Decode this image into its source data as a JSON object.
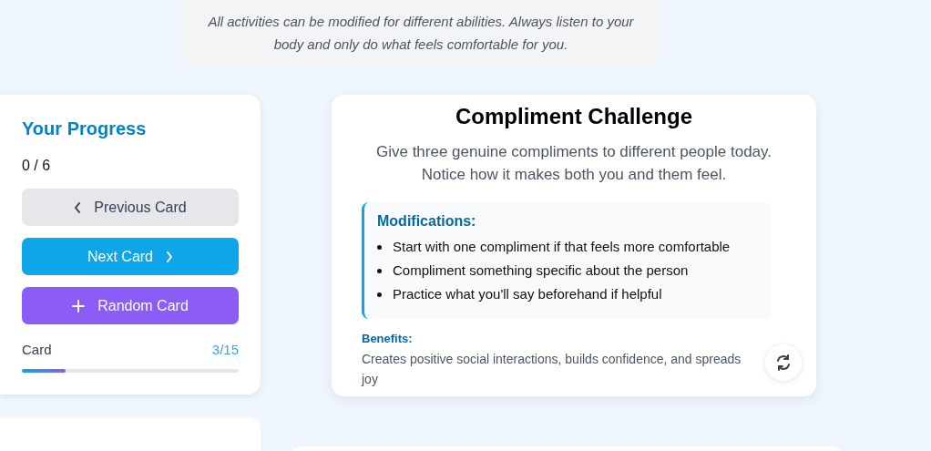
{
  "notice": "All activities can be modified for different abilities. Always listen to your body and only do what feels comfortable for you.",
  "progress": {
    "title": "Your Progress",
    "count": "0 / 6",
    "buttons": [
      {
        "kind": "previous",
        "label": "Previous Card"
      },
      {
        "kind": "next",
        "label": "Next Card"
      },
      {
        "kind": "random",
        "label": "Random Card"
      }
    ],
    "card_label": "Card",
    "card_reading": "3/15",
    "level": 0.2
  },
  "activity": {
    "title": "Compliment Challenge",
    "description": "Give three genuine compliments to different people today. Notice how it makes both you and them feel.",
    "modifications_title": "Modifications:",
    "modifications": [
      "Start with one compliment if that feels more comfortable",
      "Compliment something specific about the person",
      "Practice what you'll say beforehand if helpful"
    ],
    "benefits_title": "Benefits:",
    "benefits": "Creates positive social interactions, builds confidence, and spreads joy"
  }
}
